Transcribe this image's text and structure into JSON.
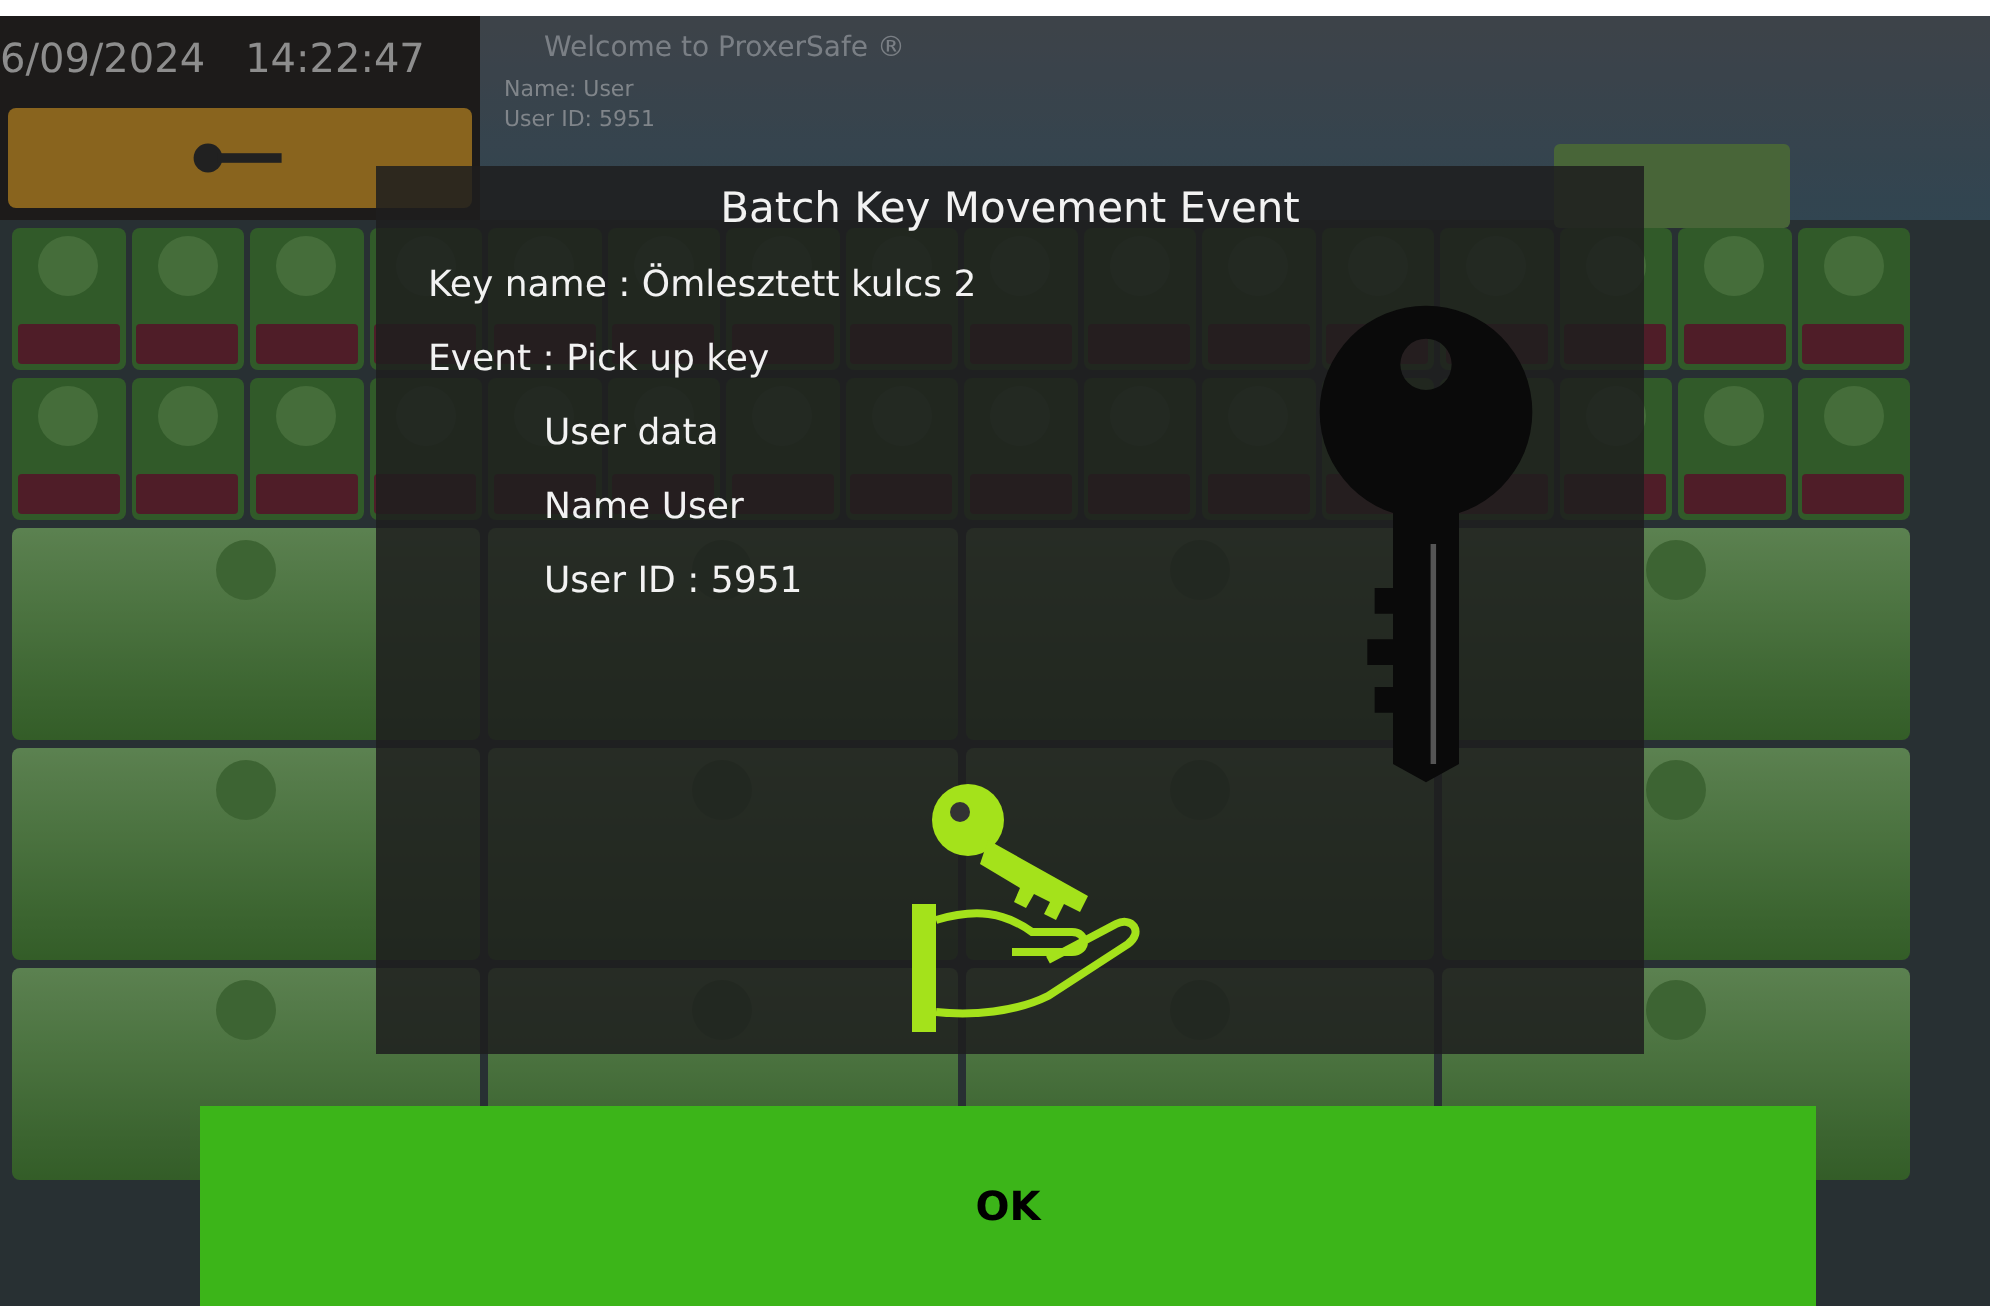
{
  "header": {
    "date": "6/09/2024",
    "time": "14:22:47",
    "welcome": "Welcome to ProxerSafe ®",
    "name_line": "Name: User",
    "user_id_line": "User ID: 5951"
  },
  "dialog": {
    "title": "Batch Key Movement Event",
    "fields": [
      "Key name : Ömlesztett kulcs 2",
      "Event : Pick up key"
    ],
    "user_section": {
      "heading": "User data",
      "lines": [
        "Name User",
        "User ID : 5951"
      ]
    }
  },
  "ok_button": {
    "label": "OK"
  }
}
